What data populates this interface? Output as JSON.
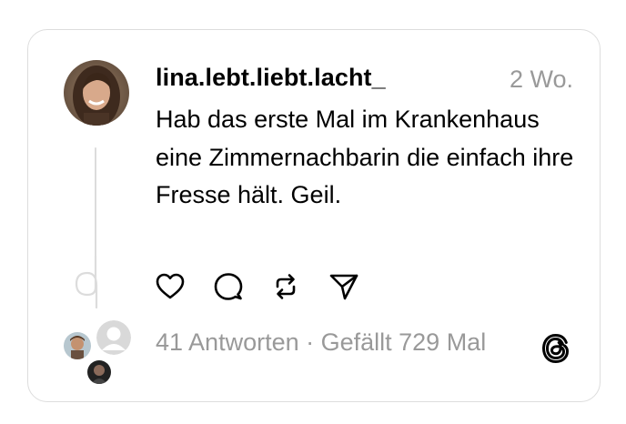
{
  "post": {
    "username": "lina.lebt.liebt.lacht_",
    "timestamp": "2 Wo.",
    "text": "Hab das erste Mal im Krankenhaus eine Zimmernachbarin die einfach ihre Fresse hält. Geil.",
    "stats": "41 Antworten · Gefällt 729 Mal"
  },
  "icons": {
    "like": "heart-icon",
    "reply": "speech-bubble-icon",
    "repost": "repost-icon",
    "share": "paper-plane-icon",
    "brand": "threads-logo"
  },
  "colors": {
    "muted_text": "#999999",
    "card_border": "#dddddd",
    "thread_line": "#dcdcdc"
  }
}
